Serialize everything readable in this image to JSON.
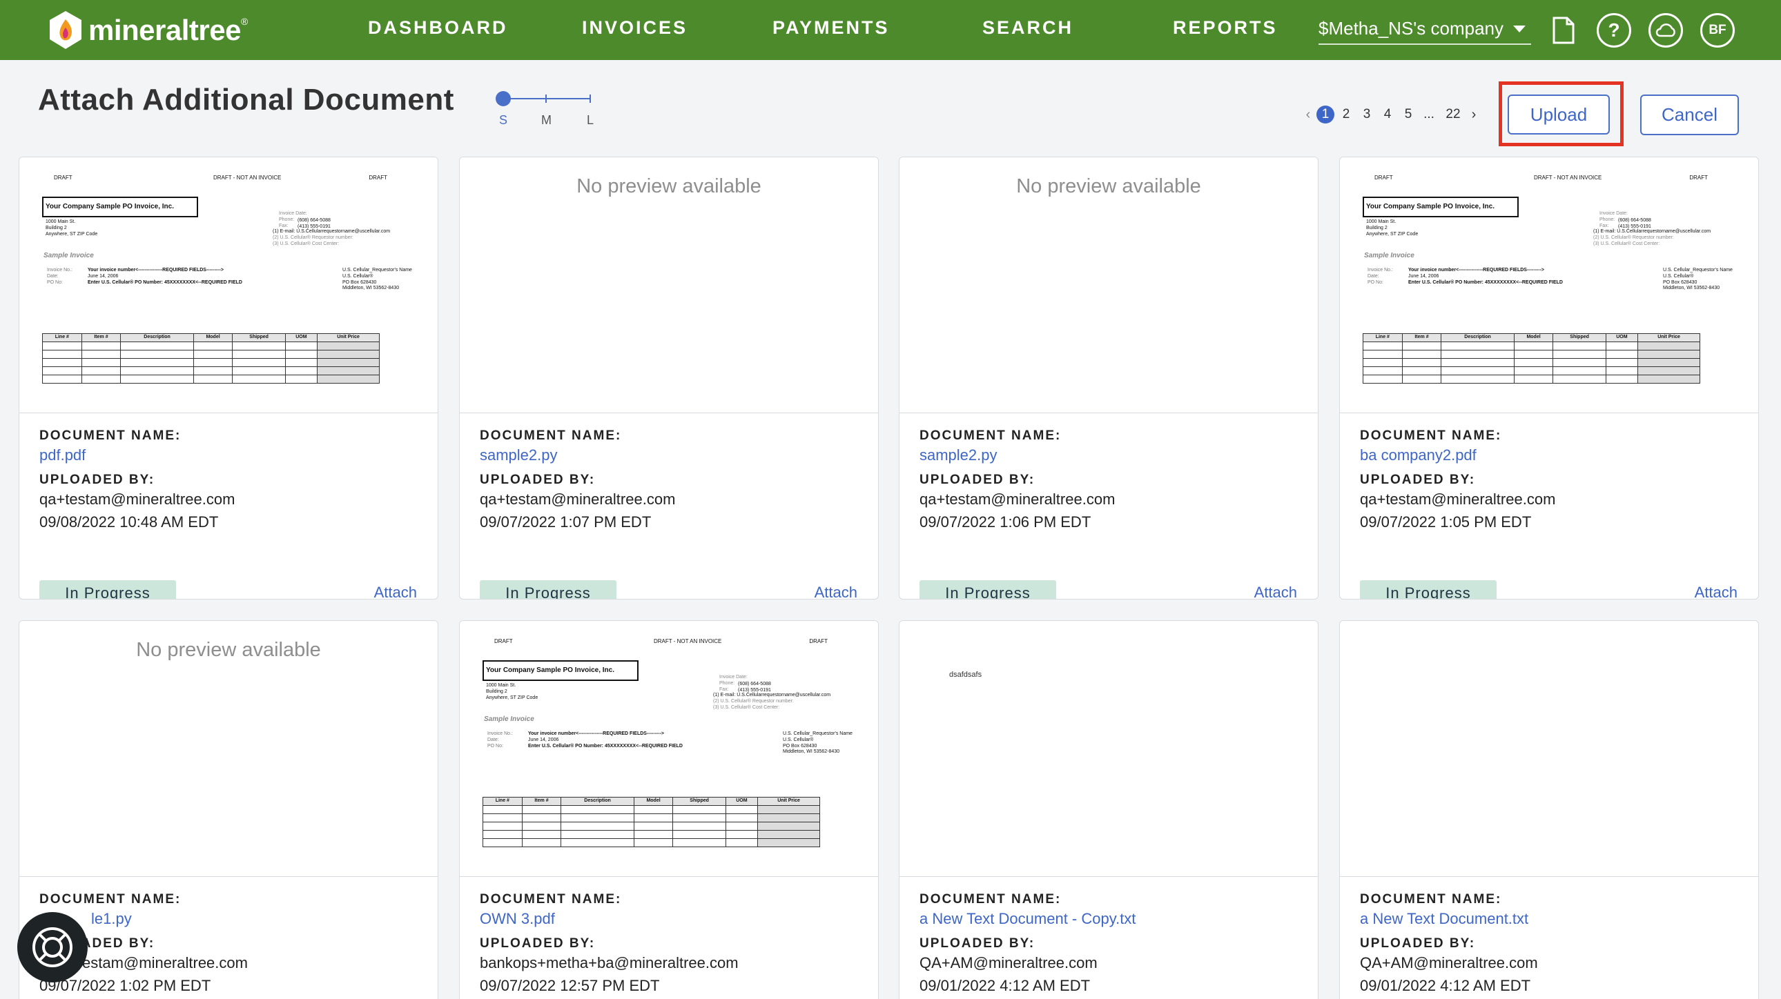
{
  "nav": {
    "brand": "mineraltree",
    "brand_mark": "®",
    "items": [
      "DASHBOARD",
      "INVOICES",
      "PAYMENTS",
      "SEARCH",
      "REPORTS"
    ],
    "company": "$Metha_NS's company",
    "icons": [
      "document-icon",
      "help-icon",
      "cloud-icon"
    ],
    "avatar": "BF",
    "help_glyph": "?"
  },
  "header": {
    "title": "Attach Additional Document",
    "size_options": [
      "S",
      "M",
      "L"
    ],
    "size_selected": "S",
    "pagination": {
      "prev": "‹",
      "pages": [
        "1",
        "2",
        "3",
        "4",
        "5"
      ],
      "ellipsis": "...",
      "last": "22",
      "next": "›",
      "current": "1"
    },
    "upload_label": "Upload",
    "cancel_label": "Cancel"
  },
  "labels": {
    "document_name": "DOCUMENT NAME:",
    "uploaded_by": "UPLOADED BY:",
    "no_preview": "No preview available",
    "attach": "Attach"
  },
  "invoice_preview": {
    "draft": "DRAFT",
    "draft_center": "DRAFT - NOT AN INVOICE",
    "company": "Your Company Sample PO Invoice, Inc.",
    "address": [
      "1000 Main St.",
      "Building 2",
      "Anywhere, ST  ZIP Code"
    ],
    "sample": "Sample Invoice",
    "meta_labels": [
      "Invoice No.:",
      "Date:",
      "PO No:"
    ],
    "meta_values": [
      "Your invoice number<---------------REQUIRED FIELDS--------->",
      "June 14, 2006",
      "Enter U.S. Cellular® PO  Number:    45XXXXXXXX<--REQUIRED FIELD"
    ],
    "right_labels": [
      "Invoice Date:",
      "Phone:",
      "Fax:"
    ],
    "right_values": [
      "(608) 664-5088",
      "(413) 555-0191"
    ],
    "right_lines": [
      "(1) E-mail:  U.S.Cellularrequestorname@uscellular.com",
      "(2) U.S. Cellular® Requestor number:",
      "(3) U.S. Cellular® Cost Center:"
    ],
    "bill_to": [
      "U.S. Cellular_Requestor's Name",
      "U.S. Cellular®",
      "PO Box 628430",
      "Middleton, WI  53562-8430"
    ],
    "columns": [
      "Line #",
      "Item #",
      "Description",
      "Model",
      "Shipped",
      "UOM",
      "Unit Price"
    ]
  },
  "documents": [
    {
      "name": "pdf.pdf",
      "uploaded_by": "qa+testam@mineraltree.com",
      "date": "09/08/2022 10:48 AM EDT",
      "status": "In Progress",
      "preview": "invoice"
    },
    {
      "name": "sample2.py",
      "uploaded_by": "qa+testam@mineraltree.com",
      "date": "09/07/2022 1:07 PM EDT",
      "status": "In Progress",
      "preview": "none"
    },
    {
      "name": "sample2.py",
      "uploaded_by": "qa+testam@mineraltree.com",
      "date": "09/07/2022 1:06 PM EDT",
      "status": "In Progress",
      "preview": "none"
    },
    {
      "name": "ba company2.pdf",
      "uploaded_by": "qa+testam@mineraltree.com",
      "date": "09/07/2022 1:05 PM EDT",
      "status": "In Progress",
      "preview": "invoice"
    },
    {
      "name": "sample1.py",
      "visible_name": "le1.py",
      "uploaded_by": "qa+testam@mineraltree.com",
      "visible_uploaded_by": "estam@mineraltree.com",
      "date": "09/07/2022 1:02 PM EDT",
      "preview": "none"
    },
    {
      "name": "OWN 3.pdf",
      "uploaded_by": "bankops+metha+ba@mineraltree.com",
      "date": "09/07/2022 12:57 PM EDT",
      "preview": "invoice"
    },
    {
      "name": "a New Text Document - Copy.txt",
      "uploaded_by": "QA+AM@mineraltree.com",
      "date": "09/01/2022 4:12 AM EDT",
      "preview": "text",
      "preview_text": "dsafdsafs"
    },
    {
      "name": "a New Text Document.txt",
      "uploaded_by": "QA+AM@mineraltree.com",
      "date": "09/01/2022 4:12 AM EDT",
      "preview": "blank"
    }
  ],
  "support_button": "help-bubble-icon",
  "colors": {
    "nav_bg": "#4d8a2c",
    "accent": "#3d66c8",
    "status_bg": "#cde6dc",
    "highlight": "#e53323"
  }
}
